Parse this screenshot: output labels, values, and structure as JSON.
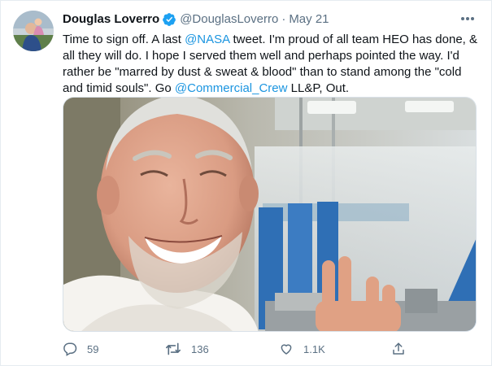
{
  "tweet": {
    "author": {
      "display_name": "Douglas Loverro",
      "handle": "@DouglasLoverro",
      "verified": true,
      "avatar_icon": "profile-photo"
    },
    "separator": "·",
    "date": "May 21",
    "text": {
      "p1": "Time to sign off. A last ",
      "mention_nasa": "@NASA",
      "p2": " tweet. I'm proud of all team HEO has done, & all they will do. I hope I served them well and perhaps pointed the way. I'd rather be \"marred by dust & sweat & blood\" than to stand among the \"cold and timid souls\". Go ",
      "mention_crew": "@Commercial_Crew",
      "p3": " LL&P, Out."
    },
    "media": {
      "type": "photo",
      "subject": "smiling man giving a Vulcan salute"
    },
    "stats": {
      "replies": "59",
      "retweets": "136",
      "likes": "1.1K"
    },
    "icons": {
      "reply": "speech-bubble-icon",
      "retweet": "retweet-arrows-icon",
      "like": "heart-icon",
      "share": "share-upload-icon",
      "more": "more-dots-icon",
      "verified": "verified-badge-icon"
    },
    "colors": {
      "link": "#1b95e0",
      "verified": "#1da1f2",
      "muted": "#5b7083"
    }
  }
}
